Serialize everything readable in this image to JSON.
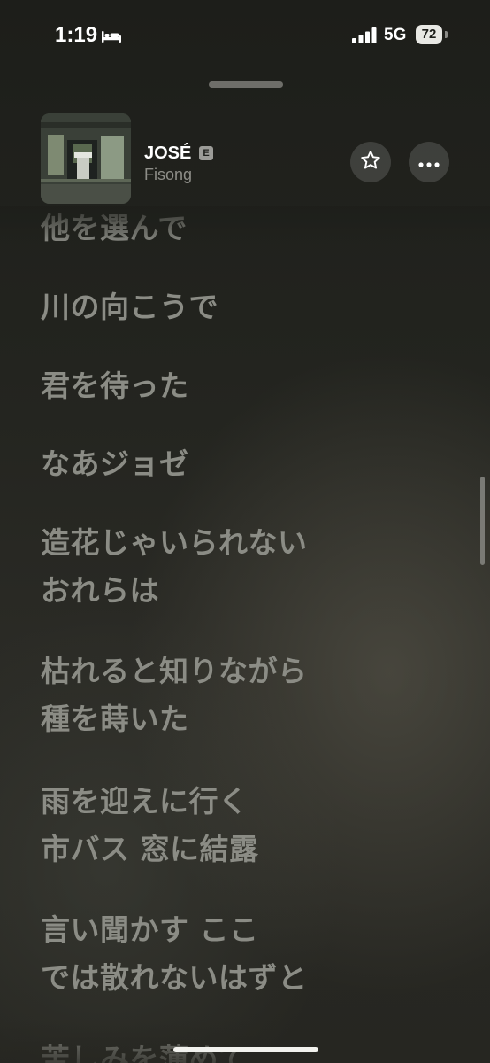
{
  "status_bar": {
    "time": "1:19",
    "focus_icon": "bed-icon",
    "signal_icon": "cellular-signal-icon",
    "network": "5G",
    "battery_percent": "72"
  },
  "now_playing": {
    "title": "JOSÉ",
    "explicit_badge": "E",
    "artist": "Fisong",
    "artwork_icon": "album-artwork",
    "favorite_icon": "star-icon",
    "more_icon": "more-icon"
  },
  "lyrics": [
    "他を選んで",
    "川の向こうで",
    "君を待った",
    "なあジョゼ",
    "造花じゃいられない",
    "おれらは",
    "枯れると知りながら",
    "種を蒔いた",
    "雨を迎えに行く",
    "市バス 窓に結露",
    "言い聞かす ここ",
    "では散れないはずと",
    "苦しみを薄めて"
  ],
  "colors": {
    "background": "#1c1d19",
    "lyric_text": "#8b8c85",
    "title_text": "#ffffff",
    "artist_text": "#8e8e88"
  }
}
